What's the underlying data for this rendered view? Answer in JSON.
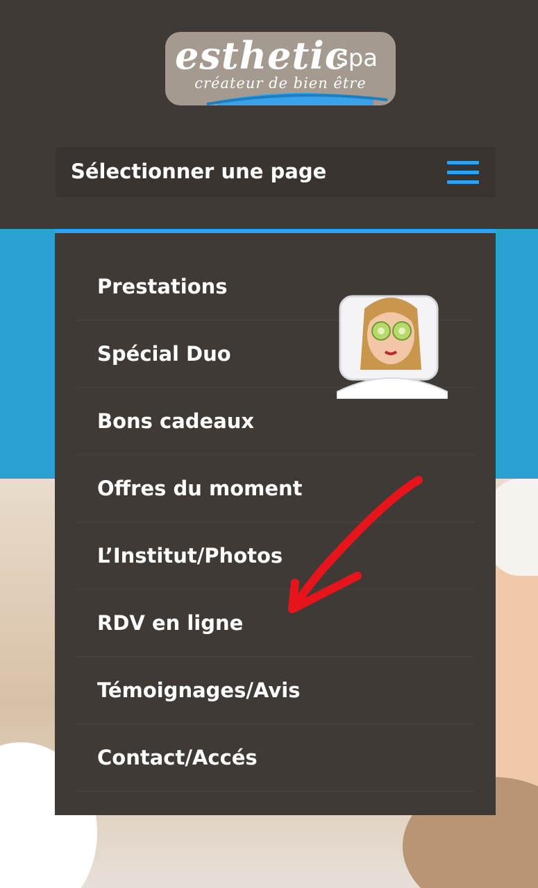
{
  "logo": {
    "wordmark": "esthetic",
    "wordmark_suffix": "spa",
    "tagline": "créateur de bien être"
  },
  "nav": {
    "select_label": "Sélectionner une page",
    "menu_icon": "hamburger-icon",
    "items": [
      {
        "label": "Prestations"
      },
      {
        "label": "Spécial Duo"
      },
      {
        "label": "Bons cadeaux"
      },
      {
        "label": "Offres du moment"
      },
      {
        "label": "L’Institut/Photos"
      },
      {
        "label": "RDV en ligne"
      },
      {
        "label": "Témoignages/Avis"
      },
      {
        "label": "Contact/Accés"
      }
    ]
  },
  "annotations": {
    "avatar": "spa-face-mask-avatar",
    "arrow": "red-arrow-annotation"
  },
  "colors": {
    "background": "#403a37",
    "accent_blue": "#2ea3f2",
    "band_blue": "#2ba0d3",
    "logo_badge": "#a49a8f",
    "annotation_red": "#e8141c"
  }
}
